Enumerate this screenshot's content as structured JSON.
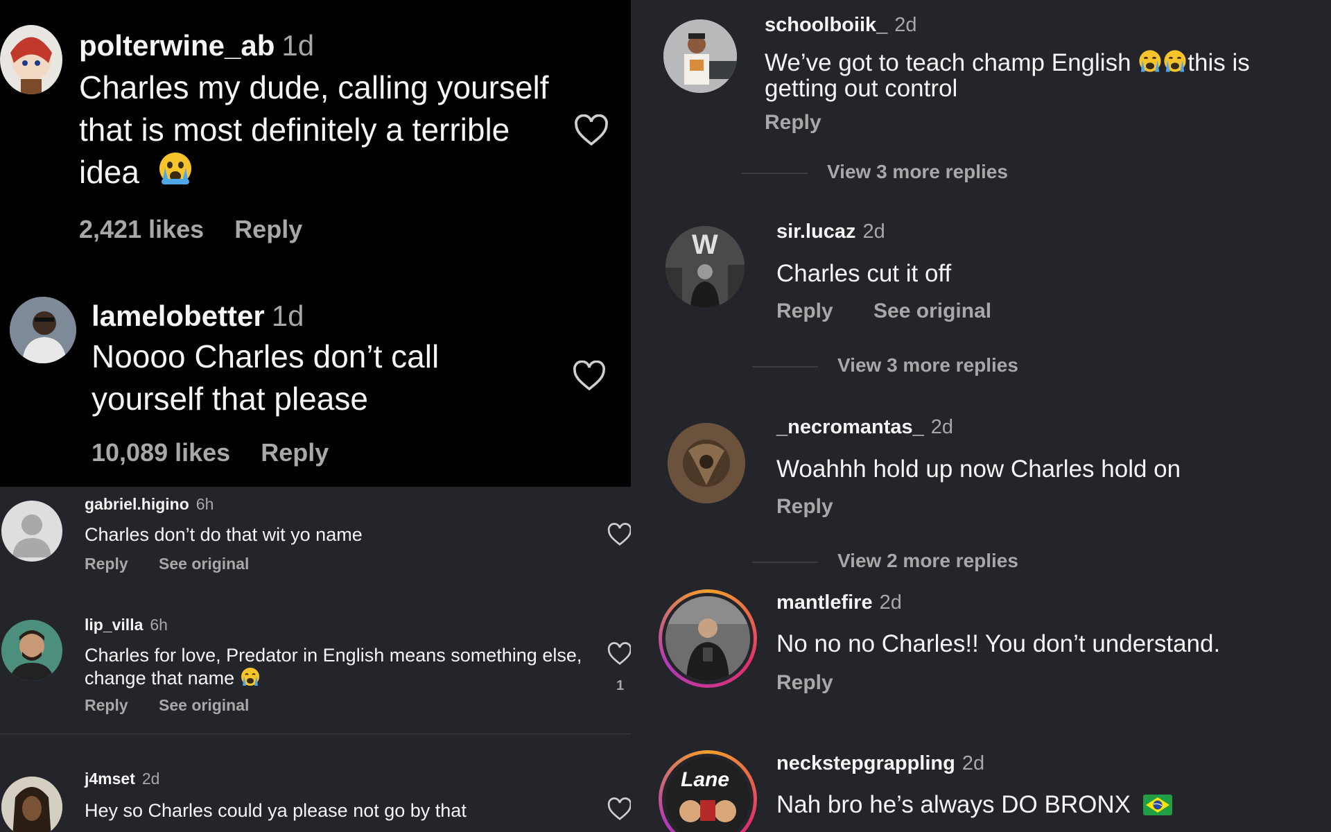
{
  "left_top": {
    "comments": [
      {
        "username": "polterwine_ab",
        "time": "1d",
        "text": "Charles my dude, calling yourself that is most definitely a terrible idea",
        "emoji": "crying-face",
        "likes": "2,421 likes",
        "reply": "Reply"
      },
      {
        "username": "lamelobetter",
        "time": "1d",
        "text": "Noooo Charles don’t call yourself that please",
        "likes": "10,089 likes",
        "reply": "Reply"
      }
    ]
  },
  "left_bottom": {
    "comments": [
      {
        "username": "gabriel.higino",
        "time": "6h",
        "text": "Charles don’t do that wit yo name",
        "reply": "Reply",
        "see_original": "See original"
      },
      {
        "username": "lip_villa",
        "time": "6h",
        "text": "Charles for love, Predator in English means something else, change that name",
        "emoji": "loudly-crying-face",
        "reply": "Reply",
        "see_original": "See original",
        "like_count": "1"
      },
      {
        "username": "j4mset",
        "time": "2d",
        "text": "Hey so Charles could ya please not go by that"
      }
    ]
  },
  "right": {
    "comments": [
      {
        "username": "schoolboiik_",
        "time": "2d",
        "text": "We’ve got to teach champ English",
        "text_after": "this is getting out control",
        "emoji": "loudly-crying-face",
        "reply": "Reply"
      },
      {
        "username": "sir.lucaz",
        "time": "2d",
        "text": "Charles cut it off",
        "reply": "Reply",
        "see_original": "See original"
      },
      {
        "username": "_necromantas_",
        "time": "2d",
        "text": "Woahhh hold up now Charles hold on",
        "reply": "Reply"
      },
      {
        "username": "mantlefire",
        "time": "2d",
        "text": "No no no Charles!! You don’t understand.",
        "reply": "Reply"
      },
      {
        "username": "neckstepgrappling",
        "time": "2d",
        "text": "Nah bro he’s always DO BRONX",
        "emoji": "brazil-flag"
      }
    ],
    "view_more": [
      "View 3 more replies",
      "View 3 more replies",
      "View 2 more replies"
    ],
    "avatar_logo_text": "Lane"
  },
  "colors": {
    "background": "#222328",
    "top_left_background": "#000000",
    "text": "#f5f5f5",
    "muted": "#a8a8a8",
    "story_ring": [
      "#f4a12a",
      "#e1306c",
      "#b13ab8"
    ]
  }
}
